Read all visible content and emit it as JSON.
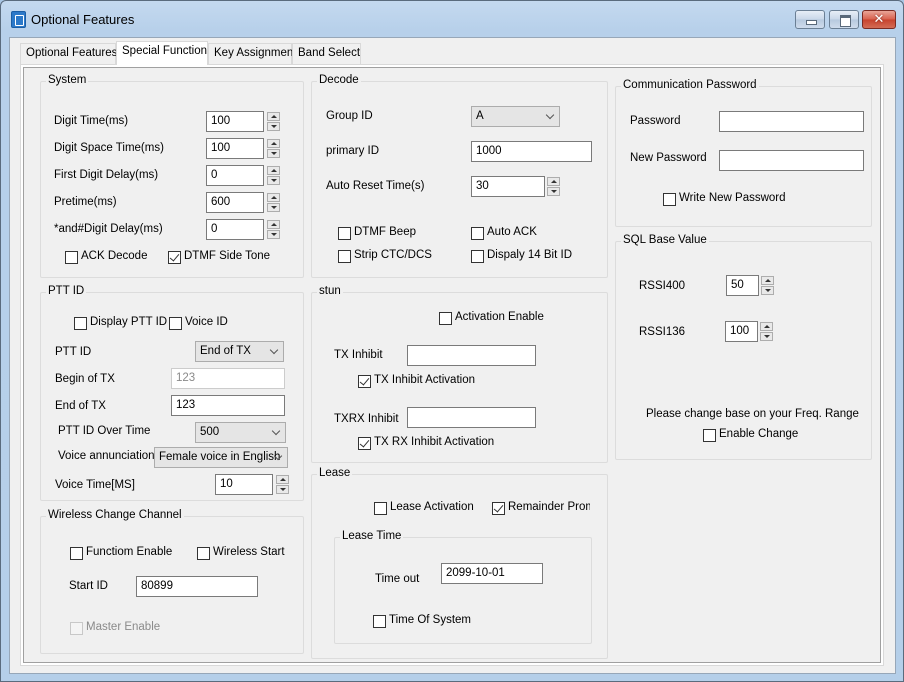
{
  "window": {
    "title": "Optional Features",
    "icon": "app-radio-icon",
    "controls": {
      "minimize": "minimize-icon",
      "maximize": "maximize-icon",
      "close": "✕"
    }
  },
  "tabs": [
    {
      "label": "Optional Features",
      "active": false
    },
    {
      "label": "Special Function",
      "active": true
    },
    {
      "label": "Key Assignment",
      "active": false
    },
    {
      "label": "Band Select",
      "active": false
    }
  ],
  "system": {
    "title": "System",
    "fields": [
      {
        "label": "Digit Time(ms)",
        "value": "100"
      },
      {
        "label": "Digit Space Time(ms)",
        "value": "100"
      },
      {
        "label": "First Digit Delay(ms)",
        "value": "0"
      },
      {
        "label": "Pretime(ms)",
        "value": "600"
      },
      {
        "label": "*and#Digit Delay(ms)",
        "value": "0"
      }
    ],
    "ack_decode": {
      "label": "ACK Decode",
      "checked": false
    },
    "dtmf_side_tone": {
      "label": "DTMF Side Tone",
      "checked": true
    }
  },
  "ptt_id": {
    "title": "PTT ID",
    "display_ptt_id": {
      "label": "Display PTT ID",
      "checked": false
    },
    "voice_id": {
      "label": "Voice ID",
      "checked": false
    },
    "ptt_id_label": "PTT ID",
    "ptt_id_value": "End of TX",
    "begin_of_tx_label": "Begin of TX",
    "begin_of_tx_value": "123",
    "end_of_tx_label": "End of TX",
    "end_of_tx_value": "123",
    "over_time_label": "PTT ID Over Time",
    "over_time_value": "500",
    "voice_annunciation_label": "Voice annunciation",
    "voice_annunciation_value": "Female voice in English",
    "voice_time_label": "Voice Time[MS]",
    "voice_time_value": "10"
  },
  "wireless": {
    "title": "Wireless Change Channel",
    "function_enable": {
      "label": "Functiom Enable",
      "checked": false
    },
    "wireless_start": {
      "label": "Wireless Start",
      "checked": false
    },
    "start_id_label": "Start ID",
    "start_id_value": "80899",
    "master_enable": {
      "label": "Master Enable",
      "checked": false,
      "disabled": true
    }
  },
  "decode": {
    "title": "Decode",
    "group_id_label": "Group ID",
    "group_id_value": "A",
    "primary_id_label": "primary ID",
    "primary_id_value": "1000",
    "auto_reset_label": "Auto Reset Time(s)",
    "auto_reset_value": "30",
    "dtmf_beep": {
      "label": "DTMF Beep",
      "checked": false
    },
    "auto_ack": {
      "label": "Auto ACK",
      "checked": false
    },
    "strip_ctc": {
      "label": "Strip CTC/DCS",
      "checked": false
    },
    "display_14bit": {
      "label": "Dispaly 14 Bit ID",
      "checked": false
    }
  },
  "stun": {
    "title": "stun",
    "activation_enable": {
      "label": "Activation Enable",
      "checked": false
    },
    "tx_inhibit_label": "TX Inhibit",
    "tx_inhibit_value": "",
    "tx_inhibit_activation": {
      "label": "TX Inhibit Activation",
      "checked": true
    },
    "txrx_inhibit_label": "TXRX Inhibit",
    "txrx_inhibit_value": "",
    "txrx_inhibit_activation": {
      "label": "TX RX Inhibit Activation",
      "checked": true
    }
  },
  "lease": {
    "title": "Lease",
    "lease_activation": {
      "label": "Lease Activation",
      "checked": false
    },
    "remainder_prompt": {
      "label": "Remainder Promp",
      "checked": true
    },
    "lease_time_title": "Lease Time",
    "time_out_label": "Time out",
    "time_out_value": "2099-10-01",
    "time_of_system": {
      "label": "Time Of System",
      "checked": false
    }
  },
  "comm_password": {
    "title": "Communication Password",
    "password_label": "Password",
    "password_value": "",
    "new_password_label": "New Password",
    "new_password_value": "",
    "write_new_password": {
      "label": "Write New Password",
      "checked": false
    }
  },
  "sql_base": {
    "title": "SQL Base Value",
    "rssi400_label": "RSSI400",
    "rssi400_value": "50",
    "rssi136_label": "RSSI136",
    "rssi136_value": "100",
    "note": "Please change base on your Freq. Range",
    "enable_change": {
      "label": "Enable Change",
      "checked": false
    }
  }
}
